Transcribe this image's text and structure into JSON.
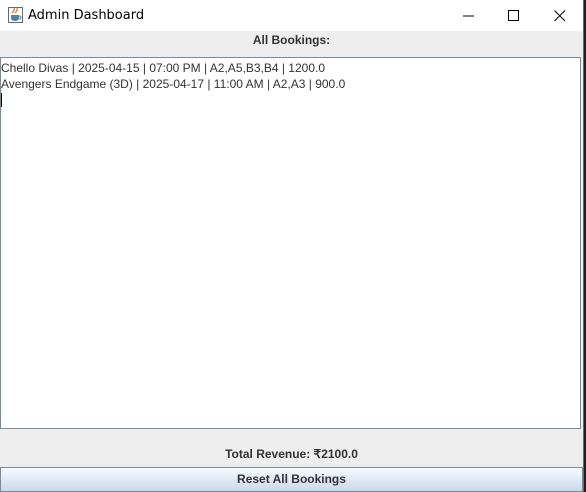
{
  "window": {
    "title": "Admin Dashboard",
    "icon": "java-cup-icon",
    "controls": [
      "minimize",
      "maximize",
      "close"
    ]
  },
  "header": {
    "label": "All Bookings:"
  },
  "bookings_text": {
    "lines": [
      "Chello Divas | 2025-04-15 | 07:00 PM | A2,A5,B3,B4 | 1200.0",
      "Avengers Endgame (3D) | 2025-04-17 | 11:00 AM | A2,A3 | 900.0"
    ]
  },
  "footer": {
    "revenue_label": "Total Revenue: ₹2100.0",
    "reset_button_label": "Reset All Bookings"
  }
}
